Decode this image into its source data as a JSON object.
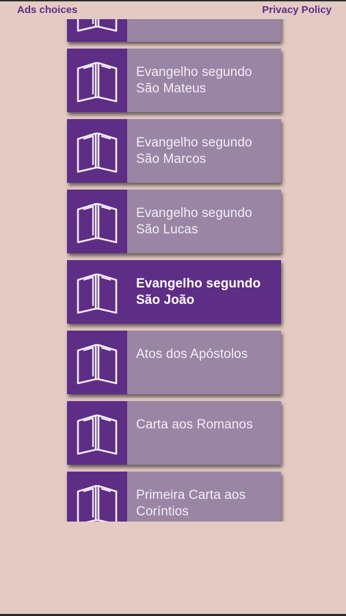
{
  "topbar": {
    "ads_label": "Ads choices",
    "privacy_label": "Privacy Policy"
  },
  "books": [
    {
      "label": "",
      "selected": false
    },
    {
      "label": "Evangelho segundo São Mateus",
      "selected": false
    },
    {
      "label": "Evangelho segundo São Marcos",
      "selected": false
    },
    {
      "label": "Evangelho segundo São Lucas",
      "selected": false
    },
    {
      "label": "Evangelho segundo São João",
      "selected": true
    },
    {
      "label": "Atos dos Apóstolos",
      "selected": false
    },
    {
      "label": "Carta aos Romanos",
      "selected": false
    },
    {
      "label": "Primeira Carta aos Coríntios",
      "selected": false
    }
  ],
  "icons": {
    "book": "open-book-icon"
  },
  "colors": {
    "background": "#e3cbc3",
    "accent": "#5e2d85",
    "item": "#9a85a5",
    "text": "#f3eef5"
  }
}
